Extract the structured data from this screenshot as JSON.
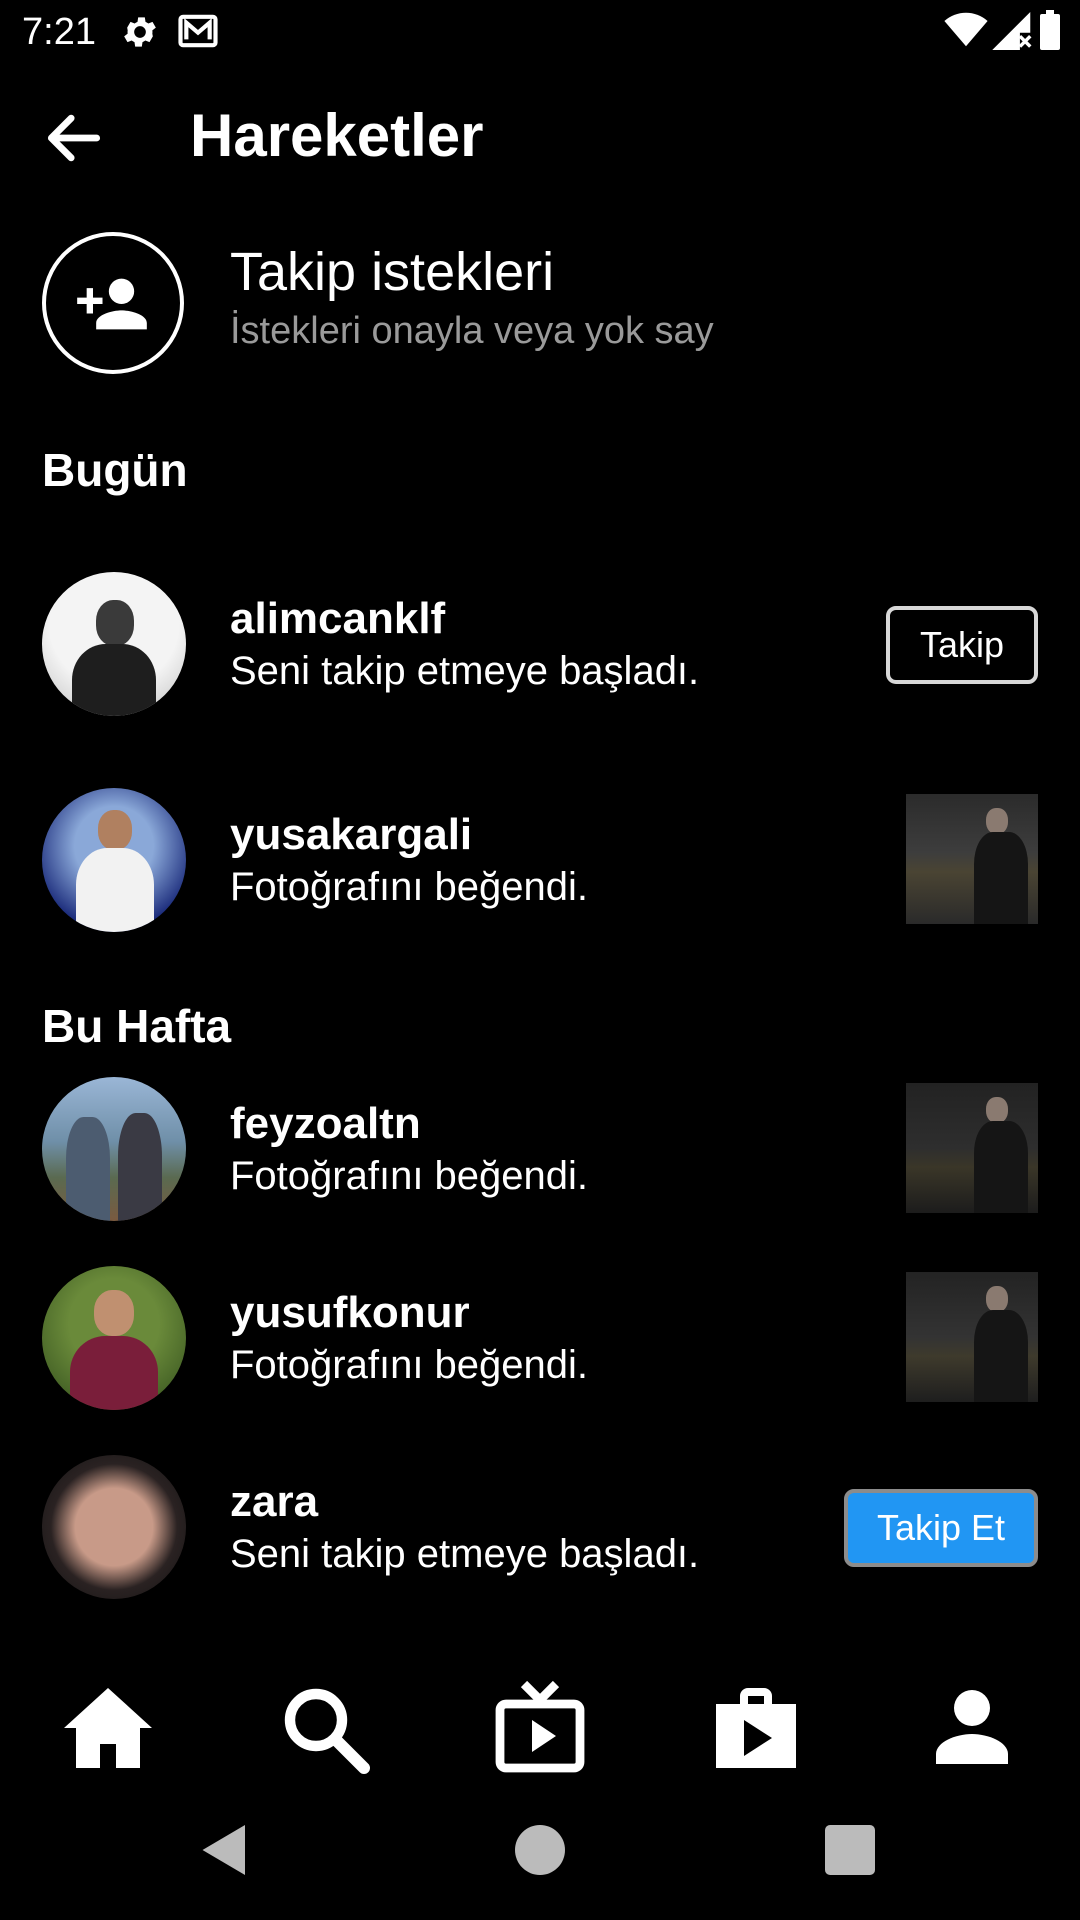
{
  "status_bar": {
    "time": "7:21",
    "icons": [
      "gear-icon",
      "mail-icon",
      "wifi-icon",
      "signal-icon",
      "battery-icon"
    ]
  },
  "header": {
    "title": "Hareketler",
    "back_icon": "arrow-left-icon"
  },
  "follow_requests": {
    "title": "Takip istekleri",
    "subtitle": "İstekleri onayla veya yok say",
    "icon": "person-add-icon"
  },
  "sections": [
    {
      "label": "Bugün",
      "items": [
        {
          "username": "alimcanklf",
          "action": "Seni takip etmeye başladı.",
          "button": "Takip"
        },
        {
          "username": "yusakargali",
          "action": "Fotoğrafını beğendi."
        }
      ]
    },
    {
      "label": "Bu Hafta",
      "items": [
        {
          "username": "feyzoaltn",
          "action": "Fotoğrafını beğendi."
        },
        {
          "username": "yusufkonur",
          "action": "Fotoğrafını beğendi."
        },
        {
          "username": "zara",
          "action": "Seni takip etmeye başladı.",
          "button": "Takip Et"
        }
      ]
    }
  ],
  "bottom_nav": [
    "home-icon",
    "search-icon",
    "tv-icon",
    "shop-icon",
    "profile-icon"
  ],
  "system_nav": [
    "back-triangle-icon",
    "home-circle-icon",
    "recents-square-icon"
  ],
  "colors": {
    "background": "#000000",
    "accent": "#2196f3",
    "secondary_text": "#9a9a9a"
  }
}
